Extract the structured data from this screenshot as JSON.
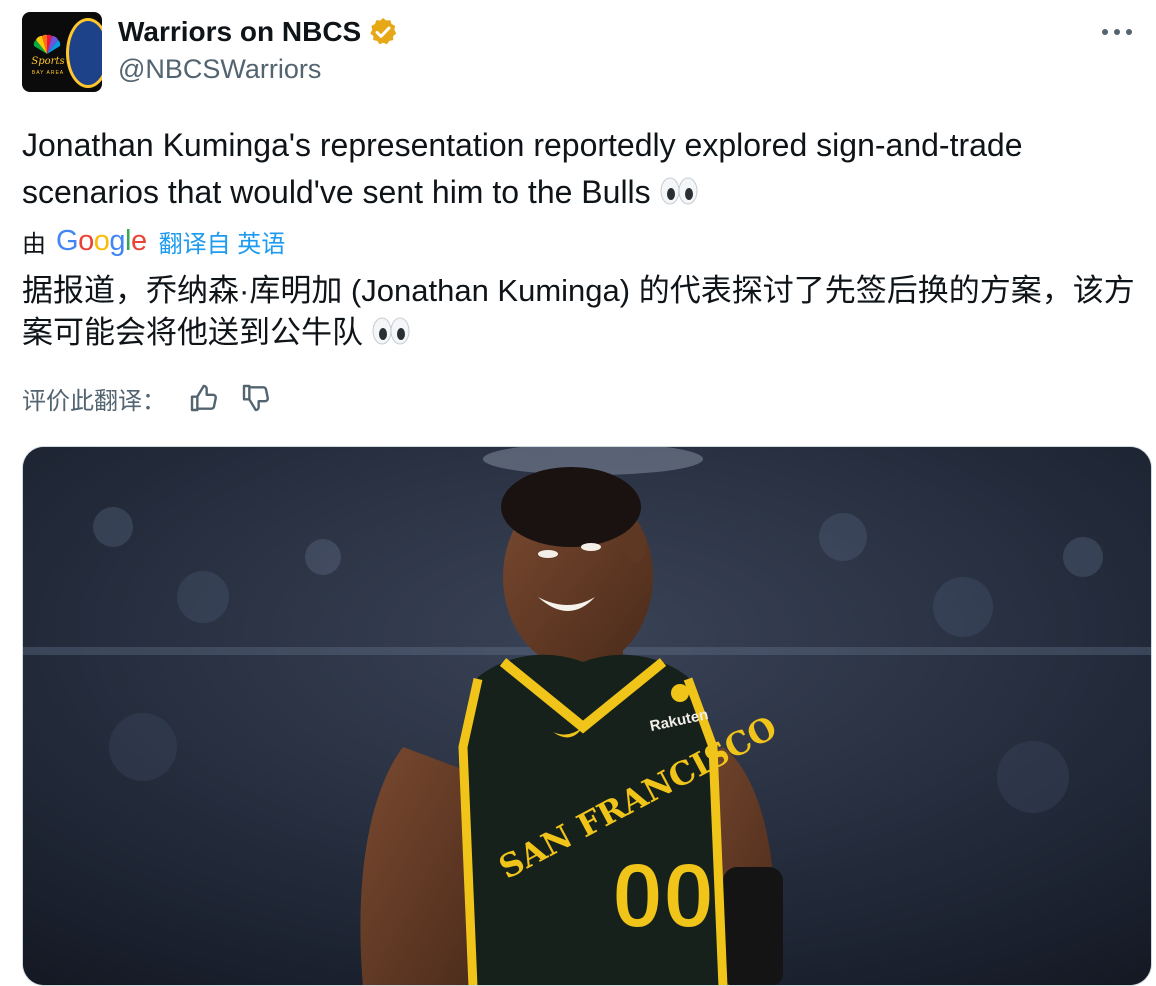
{
  "account": {
    "display_name": "Warriors on NBCS",
    "handle": "@NBCSWarriors",
    "verified_color": "#e6a817",
    "avatar_logo_text": "Sports",
    "avatar_logo_subtext": "BAY AREA"
  },
  "tweet": {
    "line1": "Jonathan Kuminga's representation reportedly explored sign-and-trade",
    "line2": "scenarios that would've sent him to the Bulls"
  },
  "translation": {
    "by_label": "由",
    "provider": "Google",
    "link_label": "翻译自 英语",
    "text": "据报道，乔纳森·库明加 (Jonathan Kuminga) 的代表探讨了先签后换的方案，该方案可能会将他送到公牛队"
  },
  "rating": {
    "label": "评价此翻译："
  },
  "media": {
    "jersey_city": "SAN FRANCISCO",
    "jersey_number": "00",
    "jersey_sponsor": "Rakuten",
    "jersey_color": "#16211c",
    "trim_color": "#f0c419"
  }
}
